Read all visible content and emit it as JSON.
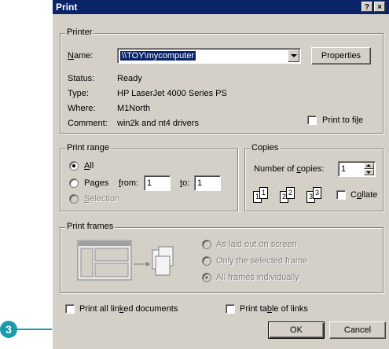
{
  "dialog": {
    "title": "Print",
    "help_glyph": "?",
    "close_glyph": "×"
  },
  "printer": {
    "legend": "Printer",
    "name_label": "Name:",
    "name_value": "\\\\TOY\\mycomputer",
    "properties_label": "Properties",
    "status_label": "Status:",
    "status_value": "Ready",
    "type_label": "Type:",
    "type_value": "HP LaserJet 4000 Series PS",
    "where_label": "Where:",
    "where_value": "M1North",
    "comment_label": "Comment:",
    "comment_value": "win2k and nt4 drivers",
    "print_to_file_label": "Print to file"
  },
  "print_range": {
    "legend": "Print range",
    "all_label": "All",
    "pages_label": "Pages",
    "from_label": "from:",
    "from_value": "1",
    "to_label": "to:",
    "to_value": "1",
    "selection_label": "Selection"
  },
  "copies": {
    "legend": "Copies",
    "number_label": "Number of copies:",
    "number_value": "1",
    "collate_label": "Collate",
    "collate_pages": [
      "1",
      "1",
      "2",
      "2",
      "3",
      "3"
    ]
  },
  "print_frames": {
    "legend": "Print frames",
    "as_laid_out_label": "As laid out on screen",
    "only_selected_label": "Only the selected frame",
    "all_frames_label": "All frames individually"
  },
  "options": {
    "print_linked_label": "Print all linked documents",
    "print_table_label": "Print table of links"
  },
  "buttons": {
    "ok_label": "OK",
    "cancel_label": "Cancel"
  },
  "callout": {
    "number": "3",
    "color": "#1a9bb0"
  }
}
